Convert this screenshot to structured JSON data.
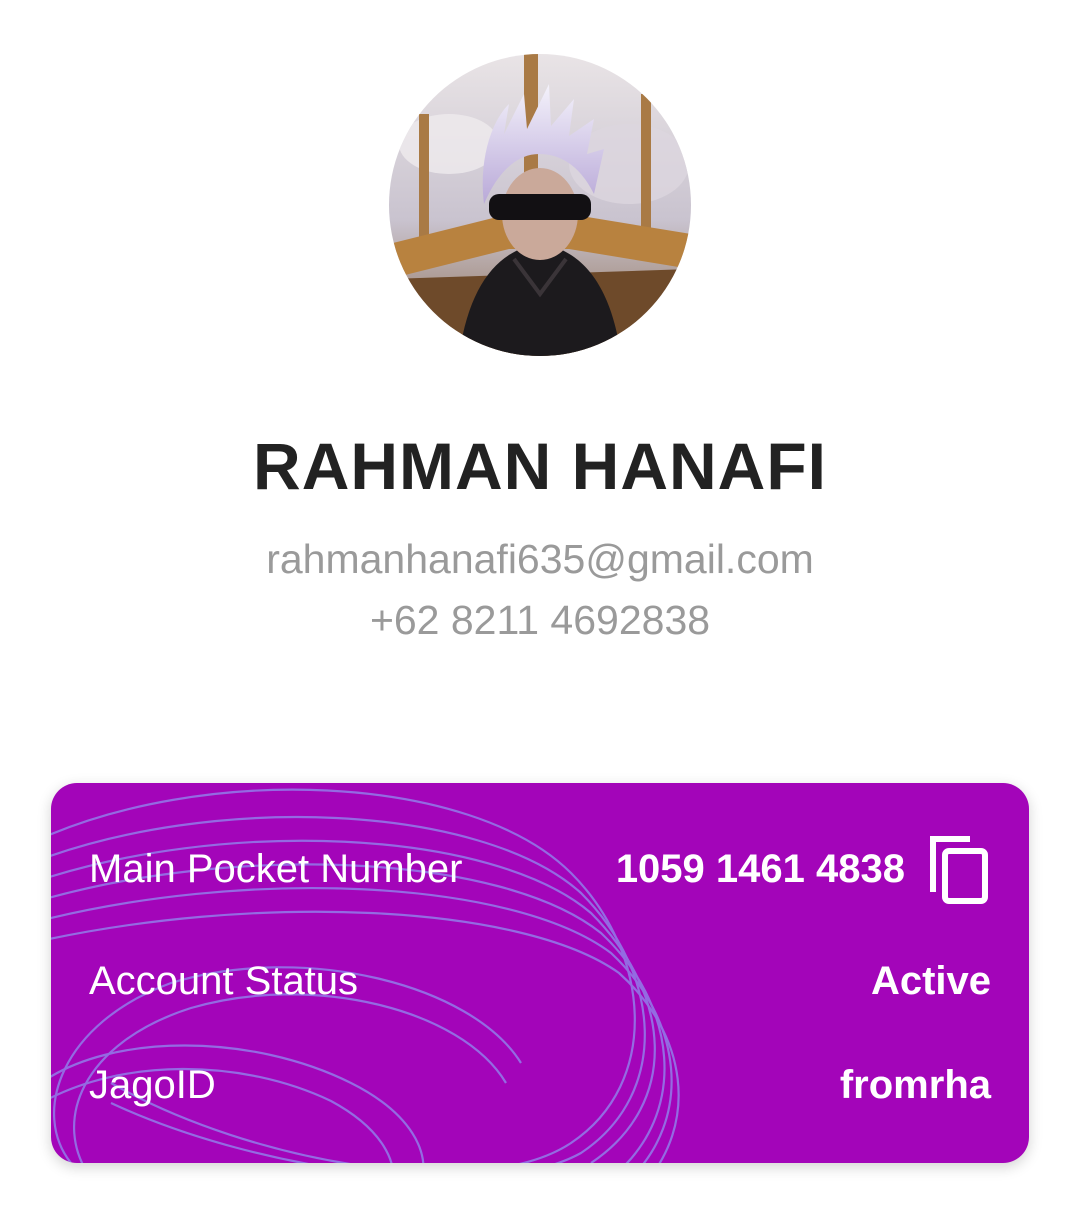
{
  "profile": {
    "avatar_icon": "profile-photo",
    "name": "RAHMAN HANAFI",
    "email": "rahmanhanafi635@gmail.com",
    "phone": "+62 8211 4692838"
  },
  "account_card": {
    "background_color": "#a305b9",
    "rows": [
      {
        "label": "Main Pocket Number",
        "value": "1059 1461 4838",
        "action_icon": "copy-icon"
      },
      {
        "label": "Account Status",
        "value": "Active"
      },
      {
        "label": "JagoID",
        "value": "fromrha"
      }
    ]
  }
}
